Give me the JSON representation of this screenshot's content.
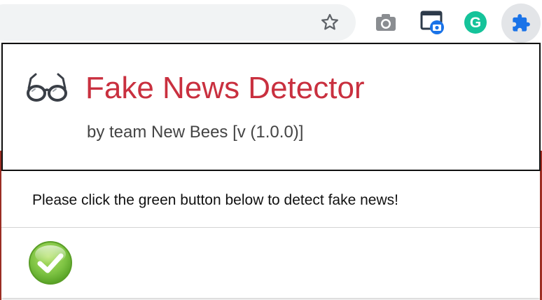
{
  "toolbar": {
    "icons": [
      "star-icon",
      "camera-icon",
      "screen-capture-icon",
      "grammarly-icon",
      "puzzle-icon"
    ],
    "grammarly_letter": "G"
  },
  "popup": {
    "title": "Fake News Detector",
    "subtitle": "by team New Bees [v (1.0.0)]",
    "message": "Please click the green button below to detect fake news!",
    "title_color": "#c9303f",
    "button_color": "#7cc242"
  }
}
